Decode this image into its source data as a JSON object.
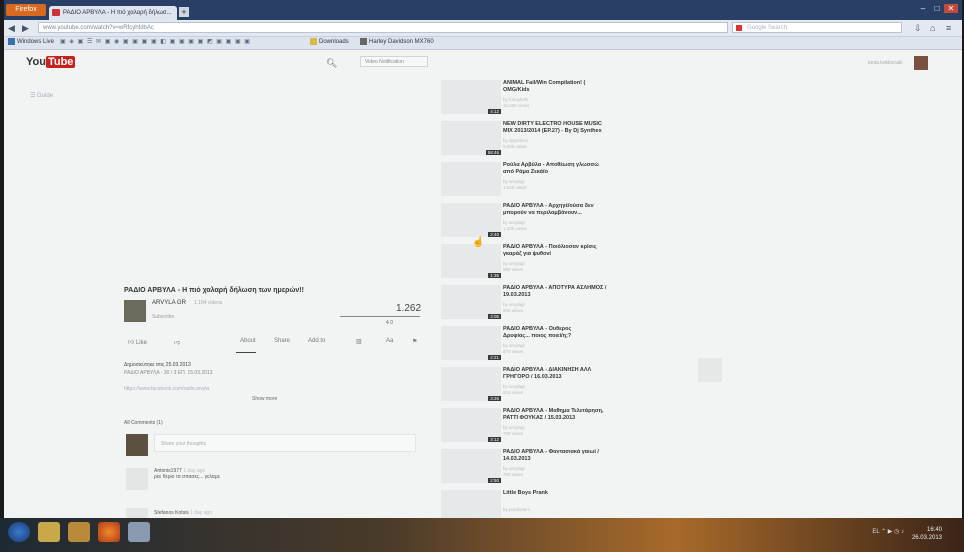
{
  "browser": {
    "menu_label": "Firefox",
    "tab_title": "ΡΑΔΙΟ ΑΡΒΥΛΑ - Η πιό χαλαρή δήλωσ...",
    "new_tab": "+",
    "url": "www.youtube.com/watch?v=wRfcyhfdbAc",
    "search_placeholder": "Google Search",
    "bookmarks": [
      "Windows Live",
      "Downloads",
      "Harley Davidson MX760"
    ]
  },
  "youtube": {
    "logo_you": "You",
    "logo_tube": "Tube",
    "search_dropdown": "Video Notification",
    "username": "tonia.kokkonaki",
    "guide_label": "Guide"
  },
  "video": {
    "title": "ΡΑΔΙΟ ΑΡΒΥΛΑ - Η πιό χαλαρή δήλωση των ημερών!!",
    "channel": "ARVYLA GR",
    "channel_count": "1,184 videos",
    "subscribe": "Subscribe",
    "views": "1.262",
    "likes": "4     0",
    "actions": [
      "Like",
      "About",
      "Share",
      "Add to",
      "Statistics",
      "Report"
    ],
    "published": "Δημοσιεύτηκε στις 25.03.2013",
    "description": "ΡΑΔΙΟ ΑΡΒΥΛΑ - 30 / 3 ΕΠ. 15.03.2013",
    "link": "https://www.facebook.com/radio.arvyla",
    "show_more": "Show more",
    "comments_header": "All Comments (1)",
    "comment_placeholder": "Share your thoughts",
    "comments": [
      {
        "name": "Antonis1977",
        "time": "1 day ago",
        "text": "ρεε θεριο τα σπασες... γελαμε"
      },
      {
        "name": "Stefanos Kotsis",
        "time": "1 day ago",
        "text": ""
      }
    ]
  },
  "sidebar": [
    {
      "title": "ANIMAL Fail/Win Compilation! (",
      "title2": "OMG/Kids",
      "meta": "by funnyfails",
      "meta2": "15,000 views",
      "duration": "4:12"
    },
    {
      "title": "NEW DIRTY ELECTRO HOUSE MUSIC",
      "title2": "MIX 2013/2014 (EP.27) - By Dj Synthex",
      "meta": "by djsynthex",
      "meta2": "9,000 views",
      "duration": "58:46"
    },
    {
      "title": "Ρούλα Αρβύλα - Αποθέωση γλωσσώ",
      "title2": "από Ράμα Ζεκάϊο",
      "meta": "by arvylagr",
      "meta2": "1,540 views",
      "duration": ""
    },
    {
      "title": "ΡΑΔΙΟ ΑΡΒΥΛΑ - Αρχηγέ/ούσα δεν",
      "title2": "μπορούν να περιλαμβάνουν...",
      "meta": "by arvylagr",
      "meta2": "1,200 views",
      "duration": "2:40"
    },
    {
      "title": "ΡΑΔΙΟ ΑΡΒΥΛΑ - Ποιόλιοσαν κρίσις",
      "title2": "γκαράζ για ψυθονί",
      "meta": "by arvylagr",
      "meta2": "980 views",
      "duration": "1:36"
    },
    {
      "title": "ΡΑΔΙΟ ΑΡΒΥΛΑ - ΑΠΟΤΥΡΑ ΑΣΛΗΜΟΣ /",
      "title2": "19.03.2013",
      "meta": "by arvylagr",
      "meta2": "900 views",
      "duration": "3:05"
    },
    {
      "title": "ΡΑΔΙΟ ΑΡΒΥΛΑ - Ουθερος",
      "title2": "Δρυφίας... ποιος ποιεί/η;?",
      "meta": "by arvylagr",
      "meta2": "870 views",
      "duration": "2:21"
    },
    {
      "title": "ΡΑΔΙΟ ΑΡΒΥΛΑ - ΔΙΑΚΙΝΗΣΗ ΑΛΛ",
      "title2": "ΓΡΗΓΟΡΟ / 16.03.2013",
      "meta": "by arvylagr",
      "meta2": "810 views",
      "duration": "3:26"
    },
    {
      "title": "ΡΑΔΙΟ ΑΡΒΥΛΑ - Μαθημα Τελετάρηση,",
      "title2": "ΡΑΤΤΙ ΦΟΥΚΑΣ / 15.03.2013",
      "meta": "by arvylagr",
      "meta2": "760 views",
      "duration": "3:12"
    },
    {
      "title": "ΡΑΔΙΟ ΑΡΒΥΛΑ - Φαντασιακά γαιωί /",
      "title2": "14.03.2013",
      "meta": "by arvylagr",
      "meta2": "700 views",
      "duration": "2:50"
    },
    {
      "title": "Little Boys Prank",
      "title2": "",
      "meta": "by pranksters",
      "meta2": "",
      "duration": "2:09"
    }
  ],
  "taskbar": {
    "time": "16:40",
    "date": "26.03.2013",
    "tray": "EL ⌃ ▶ ◷ ♪"
  }
}
